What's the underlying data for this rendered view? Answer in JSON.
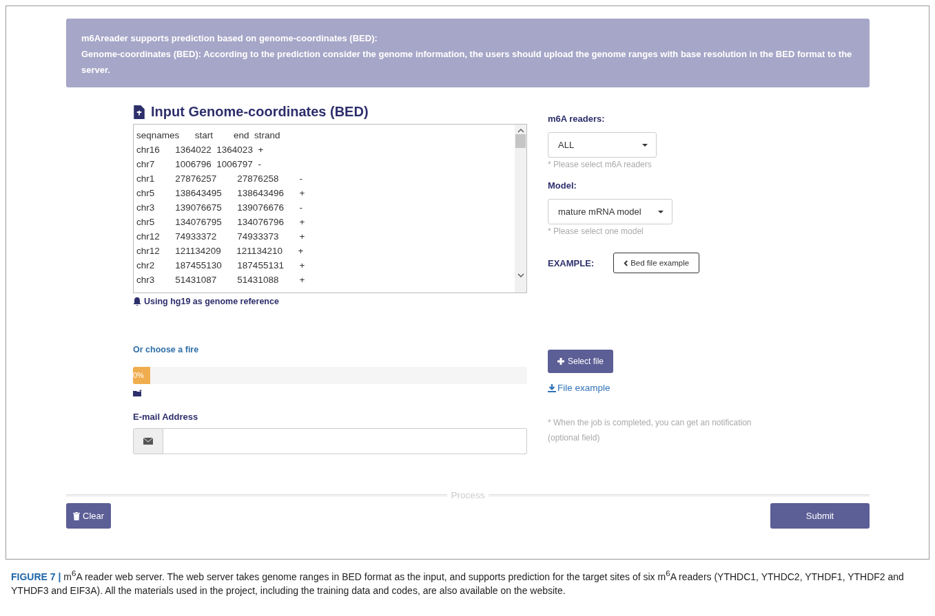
{
  "banner": {
    "title": "m6Areader supports prediction based on genome-coordinates (BED):",
    "text": "Genome-coordinates (BED): According to the prediction consider the genome information, the users should upload the genome ranges with base resolution in the BED format to the server."
  },
  "input": {
    "heading": "Input Genome-coordinates (BED)",
    "lines": [
      "seqnames      start        end  strand",
      "chr16      1364022  1364023  +",
      "chr7        1006796  1006797  -",
      "chr1        27876257        27876258        -",
      "chr5        138643495      138643496      +",
      "chr3        139076675      139076676      -",
      "chr5        134076795      134076796      +",
      "chr12      74933372        74933373        +",
      "chr12      121134209      121134210      +",
      "chr2        187455130      187455131      +",
      "chr3        51431087        51431088        +"
    ],
    "note": "Using hg19 as genome reference"
  },
  "readers": {
    "label": "m6A readers:",
    "value": "ALL",
    "hint": "* Please select m6A readers"
  },
  "model": {
    "label": "Model:",
    "value": "mature mRNA model",
    "hint": "* Please select one model"
  },
  "example": {
    "label": "EXAMPLE:",
    "button": "Bed file example"
  },
  "upload": {
    "label": "Or choose a fire",
    "progress_text": "0%",
    "level": 0,
    "select_button": "Select file",
    "file_example": "File example"
  },
  "email": {
    "label": "E-mail Address",
    "hint": "* When the job is completed, you can get an notification (optional field)"
  },
  "process": {
    "label": "Process",
    "clear": "Clear",
    "submit": "Submit"
  },
  "caption": "**FIGURE 7 |** m$^{6}$A reader web server. The web server takes genome ranges in BED format as the input, and supports prediction for the target sites of six m$^{6}$A readers (YTHDC1, YTHDC2, YTHDF1, YTHDF2 and YTHDF3 and EIF3A). All the materials used in the project, including the training data and codes, are also available on the website."
}
